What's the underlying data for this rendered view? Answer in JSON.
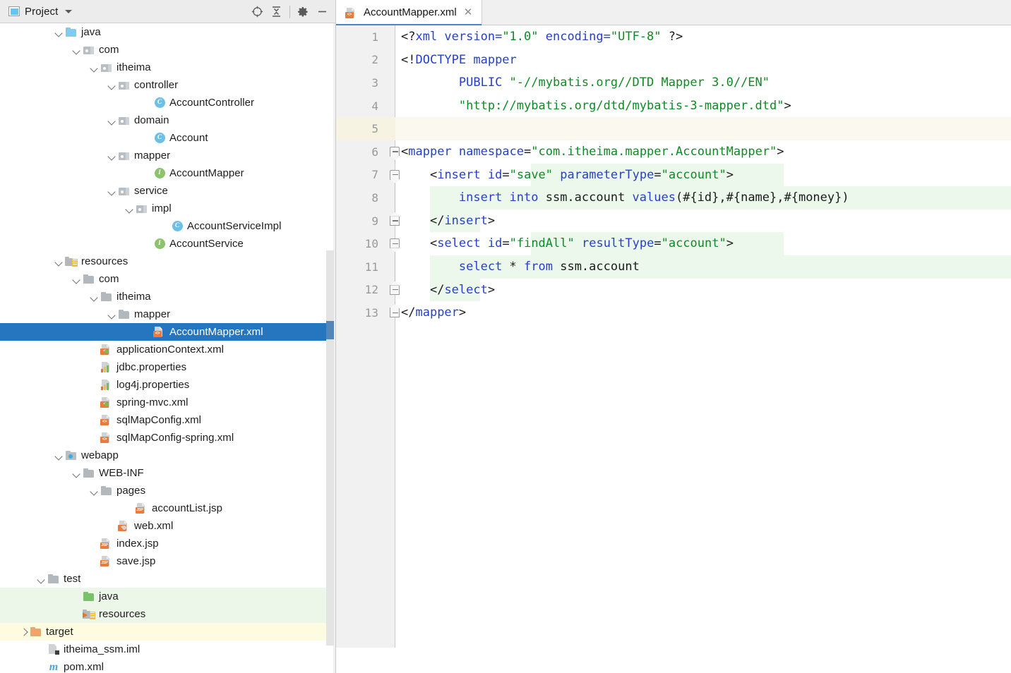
{
  "project_panel": {
    "title": "Project",
    "window_icon": "project-window-icon",
    "dropdown_icon": "chevron-down-icon",
    "tools": [
      {
        "name": "locate-icon",
        "glyph": "target"
      },
      {
        "name": "collapse-all-icon",
        "glyph": "collapse"
      },
      {
        "name": "settings-gear-icon",
        "glyph": "gear"
      },
      {
        "name": "hide-panel-icon",
        "glyph": "minus"
      }
    ],
    "tree": [
      {
        "label": "java",
        "indent": 4,
        "arrow": "down",
        "icon": "folder-blue",
        "state": "normal"
      },
      {
        "label": "com",
        "indent": 5,
        "arrow": "down",
        "icon": "package",
        "state": "normal"
      },
      {
        "label": "itheima",
        "indent": 6,
        "arrow": "down",
        "icon": "package",
        "state": "normal"
      },
      {
        "label": "controller",
        "indent": 7,
        "arrow": "down",
        "icon": "package",
        "state": "normal"
      },
      {
        "label": "AccountController",
        "indent": 9,
        "arrow": "none",
        "icon": "class",
        "state": "normal"
      },
      {
        "label": "domain",
        "indent": 7,
        "arrow": "down",
        "icon": "package",
        "state": "normal"
      },
      {
        "label": "Account",
        "indent": 9,
        "arrow": "none",
        "icon": "class",
        "state": "normal"
      },
      {
        "label": "mapper",
        "indent": 7,
        "arrow": "down",
        "icon": "package",
        "state": "normal"
      },
      {
        "label": "AccountMapper",
        "indent": 9,
        "arrow": "none",
        "icon": "interface",
        "state": "normal"
      },
      {
        "label": "service",
        "indent": 7,
        "arrow": "down",
        "icon": "package",
        "state": "normal"
      },
      {
        "label": "impl",
        "indent": 8,
        "arrow": "down",
        "icon": "package",
        "state": "normal"
      },
      {
        "label": "AccountServiceImpl",
        "indent": 10,
        "arrow": "none",
        "icon": "class",
        "state": "normal"
      },
      {
        "label": "AccountService",
        "indent": 9,
        "arrow": "none",
        "icon": "interface",
        "state": "normal"
      },
      {
        "label": "resources",
        "indent": 4,
        "arrow": "down",
        "icon": "resource-root",
        "state": "normal"
      },
      {
        "label": "com",
        "indent": 5,
        "arrow": "down",
        "icon": "folder-gray",
        "state": "normal"
      },
      {
        "label": "itheima",
        "indent": 6,
        "arrow": "down",
        "icon": "folder-gray",
        "state": "normal"
      },
      {
        "label": "mapper",
        "indent": 7,
        "arrow": "down",
        "icon": "folder-gray",
        "state": "normal"
      },
      {
        "label": "AccountMapper.xml",
        "indent": 9,
        "arrow": "none",
        "icon": "xml-file",
        "state": "selected"
      },
      {
        "label": "applicationContext.xml",
        "indent": 6,
        "arrow": "none",
        "icon": "spring-xml-file",
        "state": "normal"
      },
      {
        "label": "jdbc.properties",
        "indent": 6,
        "arrow": "none",
        "icon": "properties-file",
        "state": "normal"
      },
      {
        "label": "log4j.properties",
        "indent": 6,
        "arrow": "none",
        "icon": "properties-file",
        "state": "normal"
      },
      {
        "label": "spring-mvc.xml",
        "indent": 6,
        "arrow": "none",
        "icon": "spring-xml-file",
        "state": "normal"
      },
      {
        "label": "sqlMapConfig.xml",
        "indent": 6,
        "arrow": "none",
        "icon": "xml-file",
        "state": "normal"
      },
      {
        "label": "sqlMapConfig-spring.xml",
        "indent": 6,
        "arrow": "none",
        "icon": "xml-file",
        "state": "normal"
      },
      {
        "label": "webapp",
        "indent": 4,
        "arrow": "down",
        "icon": "webapp-folder",
        "state": "normal"
      },
      {
        "label": "WEB-INF",
        "indent": 5,
        "arrow": "down",
        "icon": "folder-gray",
        "state": "normal"
      },
      {
        "label": "pages",
        "indent": 6,
        "arrow": "down",
        "icon": "folder-gray",
        "state": "normal"
      },
      {
        "label": "accountList.jsp",
        "indent": 8,
        "arrow": "none",
        "icon": "jsp-file",
        "state": "normal"
      },
      {
        "label": "web.xml",
        "indent": 7,
        "arrow": "none",
        "icon": "web-xml-file",
        "state": "normal"
      },
      {
        "label": "index.jsp",
        "indent": 6,
        "arrow": "none",
        "icon": "jsp-file",
        "state": "normal"
      },
      {
        "label": "save.jsp",
        "indent": 6,
        "arrow": "none",
        "icon": "jsp-file",
        "state": "normal"
      },
      {
        "label": "test",
        "indent": 3,
        "arrow": "down",
        "icon": "folder-gray",
        "state": "normal"
      },
      {
        "label": "java",
        "indent": 5,
        "arrow": "none",
        "icon": "folder-green",
        "state": "green"
      },
      {
        "label": "resources",
        "indent": 5,
        "arrow": "none",
        "icon": "test-resource-root",
        "state": "green"
      },
      {
        "label": "target",
        "indent": 2,
        "arrow": "right",
        "icon": "folder-orange",
        "state": "yellow"
      },
      {
        "label": "itheima_ssm.iml",
        "indent": 3,
        "arrow": "none",
        "icon": "iml-file",
        "state": "normal"
      },
      {
        "label": "pom.xml",
        "indent": 3,
        "arrow": "none",
        "icon": "maven-file",
        "state": "normal"
      }
    ]
  },
  "editor": {
    "tab": {
      "label": "AccountMapper.xml",
      "icon": "xml-file-icon",
      "close_icon": "close-icon"
    },
    "line_numbers": [
      "1",
      "2",
      "3",
      "4",
      "5",
      "6",
      "7",
      "8",
      "9",
      "10",
      "11",
      "12",
      "13"
    ],
    "lines": [
      {
        "n": "1",
        "text": "<?xml version=\"1.0\" encoding=\"UTF-8\" ?>"
      },
      {
        "n": "2",
        "text": "<!DOCTYPE mapper"
      },
      {
        "n": "3",
        "text": "        PUBLIC \"-//mybatis.org//DTD Mapper 3.0//EN\""
      },
      {
        "n": "4",
        "text": "        \"http://mybatis.org/dtd/mybatis-3-mapper.dtd\">"
      },
      {
        "n": "5",
        "text": ""
      },
      {
        "n": "6",
        "text": "<mapper namespace=\"com.itheima.mapper.AccountMapper\">"
      },
      {
        "n": "7",
        "text": "    <insert id=\"save\" parameterType=\"account\">"
      },
      {
        "n": "8",
        "text": "        insert into ssm.account values(#{id},#{name},#{money})"
      },
      {
        "n": "9",
        "text": "    </insert>"
      },
      {
        "n": "10",
        "text": "    <select id=\"findAll\" resultType=\"account\">"
      },
      {
        "n": "11",
        "text": "        select * from ssm.account"
      },
      {
        "n": "12",
        "text": "    </select>"
      },
      {
        "n": "13",
        "text": "</mapper>"
      }
    ],
    "caret_line": "5"
  },
  "colors": {
    "selection_blue": "#2675bf",
    "tag_blue": "#2640c8",
    "string_green": "#0f8a25",
    "injection_green_bg": "#edf8ec",
    "caret_line_bg": "#fbf8ef",
    "test_source_bg": "#edf7e9",
    "excluded_bg": "#fdfbe0",
    "tab_underline": "#4d84c6"
  }
}
